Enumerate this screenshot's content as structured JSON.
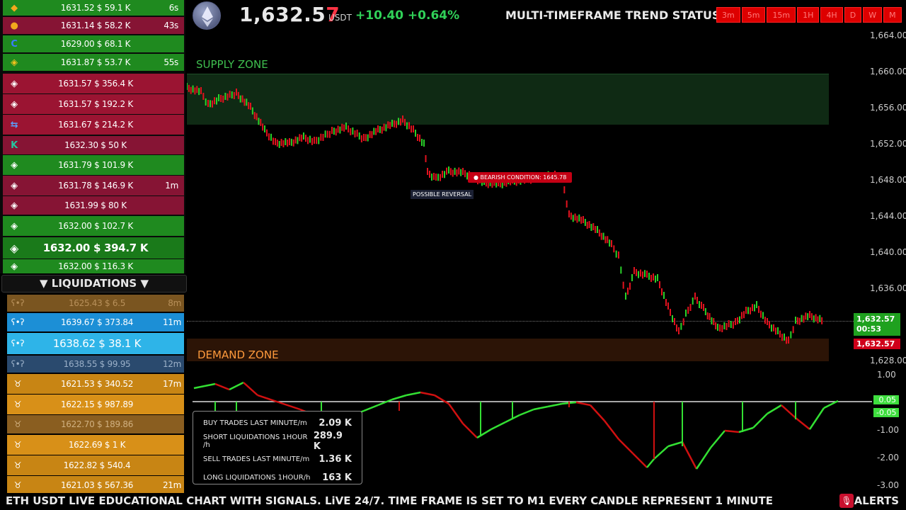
{
  "trades": [
    {
      "icon": "coin-icon",
      "glyph": "◆",
      "text": "1631.52 $ 59.1 K",
      "age": "6s",
      "color": "#1f8a1f",
      "icon_color": "#f2a81d"
    },
    {
      "icon": "coin-icon",
      "glyph": "●",
      "text": "1631.14 $ 58.2 K",
      "age": "43s",
      "color": "#861434",
      "icon_color": "#f2a81d"
    },
    {
      "icon": "coinbase-icon",
      "glyph": "C",
      "text": "1629.00 $ 68.1 K",
      "age": "",
      "color": "#1f8a1f",
      "icon_color": "#3a7bff"
    },
    {
      "icon": "binance-icon",
      "glyph": "◈",
      "text": "1631.87 $ 53.7 K",
      "age": "55s",
      "color": "#1f8a1f",
      "icon_color": "#f2c21d"
    },
    {
      "icon": "binance-icon",
      "glyph": "◈",
      "text": "1631.57 $ 356.4 K",
      "age": "",
      "color": "#9b1432",
      "icon_color": "#ffffff"
    },
    {
      "icon": "binance-icon",
      "glyph": "◈",
      "text": "1631.57 $ 192.2 K",
      "age": "",
      "color": "#9b1432",
      "icon_color": "#ffffff"
    },
    {
      "icon": "exchange-icon",
      "glyph": "⇆",
      "text": "1631.67 $ 214.2 K",
      "age": "",
      "color": "#9b1432",
      "icon_color": "#5aa0ff"
    },
    {
      "icon": "kucoin-icon",
      "glyph": "K",
      "text": "1632.30 $ 50 K",
      "age": "",
      "color": "#861434",
      "icon_color": "#26c6a0"
    },
    {
      "icon": "binance-icon",
      "glyph": "◈",
      "text": "1631.79 $ 101.9 K",
      "age": "",
      "color": "#1f8a1f",
      "icon_color": "#ffffff"
    },
    {
      "icon": "binance-icon",
      "glyph": "◈",
      "text": "1631.78 $ 146.9 K",
      "age": "1m",
      "color": "#861434",
      "icon_color": "#ffffff"
    },
    {
      "icon": "binance-icon",
      "glyph": "◈",
      "text": "1631.99 $ 80 K",
      "age": "",
      "color": "#861434",
      "icon_color": "#ffffff"
    },
    {
      "icon": "binance-icon",
      "glyph": "◈",
      "text": "1632.00 $ 102.7 K",
      "age": "",
      "color": "#1f8a1f",
      "icon_color": "#ffffff"
    },
    {
      "icon": "binance-icon",
      "glyph": "◈",
      "text": "1632.00 $ 394.7 K",
      "age": "",
      "color": "#1a7a1a",
      "icon_color": "#ffffff"
    },
    {
      "icon": "binance-icon",
      "glyph": "◈",
      "text": "1632.00 $ 116.3 K",
      "age": "",
      "color": "#1f8a1f",
      "icon_color": "#ffffff"
    }
  ],
  "liquidations_header": "▼ LIQUIDATIONS ▼",
  "liquidations": [
    {
      "text": "1625.43 $ 6.5",
      "age": "8m",
      "color": "#7a5520",
      "fg": "#b8905a"
    },
    {
      "text": "1639.67 $ 373.84",
      "age": "11m",
      "color": "#1c8fd6",
      "fg": "#ffffff"
    },
    {
      "text": "1638.62 $ 38.1 K",
      "age": "",
      "color": "#2eb4e8",
      "fg": "#ffffff"
    },
    {
      "text": "1638.55 $ 99.95",
      "age": "12m",
      "color": "#2a4a6e",
      "fg": "#9bb0c8"
    },
    {
      "text": "1621.53 $ 340.52",
      "age": "17m",
      "color": "#c88514",
      "fg": "#ffffff"
    },
    {
      "text": "1622.15 $ 987.89",
      "age": "",
      "color": "#d89018",
      "fg": "#ffffff"
    },
    {
      "text": "1622.70 $ 189.86",
      "age": "",
      "color": "#8a5e20",
      "fg": "#d0b080"
    },
    {
      "text": "1622.69 $ 1 K",
      "age": "",
      "color": "#d89018",
      "fg": "#ffffff"
    },
    {
      "text": "1622.82 $ 540.4",
      "age": "",
      "color": "#c88514",
      "fg": "#ffffff"
    },
    {
      "text": "1621.03 $ 567.36",
      "age": "21m",
      "color": "#c88514",
      "fg": "#ffffff"
    }
  ],
  "header": {
    "price_main": "1,632.5",
    "price_last": "7",
    "unit": "USDT",
    "change": "+10.40  +0.64%",
    "trend_title": "MULTI-TIMEFRAME TREND STATUS",
    "timeframes": [
      "3m",
      "5m",
      "15m",
      "1H",
      "4H",
      "D",
      "W",
      "M"
    ]
  },
  "chart": {
    "supply_label": "SUPPLY ZONE",
    "demand_label": "DEMAND ZONE",
    "bearish_tag": "● BEARISH CONDITION: 1645.78",
    "reversal_tag": "POSSIBLE REVERSAL",
    "price_box_1": "1,632.57",
    "price_box_countdown": "00:53",
    "price_box_2": "1,632.57",
    "y_ticks": [
      "1,664.00",
      "1,660.00",
      "1,656.00",
      "1,652.00",
      "1,648.00",
      "1,644.00",
      "1,640.00",
      "1,636.00",
      "1,628.00"
    ]
  },
  "oscillator": {
    "ticks": [
      "1.00",
      "-1.00",
      "-2.00",
      "-3.00"
    ],
    "value_pos": "0.05",
    "value_neg": "-0.05"
  },
  "stats": [
    {
      "label": "BUY TRADES LAST MINUTE/m",
      "value": "2.09 K"
    },
    {
      "label": "SHORT LIQUIDATIONS 1HOUR /h",
      "value": "289.9 K"
    },
    {
      "label": "SELL TRADES LAST MINUTE/m",
      "value": "1.36 K"
    },
    {
      "label": "LONG LIQUIDATIONS 1HOUR/h",
      "value": "163 K"
    }
  ],
  "ticker": {
    "text": "ETH USDT  LIVE EDUCATIONAL CHART WITH SIGNALS. LiVE 24/7.   TIME FRAME IS SET TO M1  EVERY CANDLE REPRESENT 1 MINUTE",
    "alerts": "ALERTS"
  }
}
